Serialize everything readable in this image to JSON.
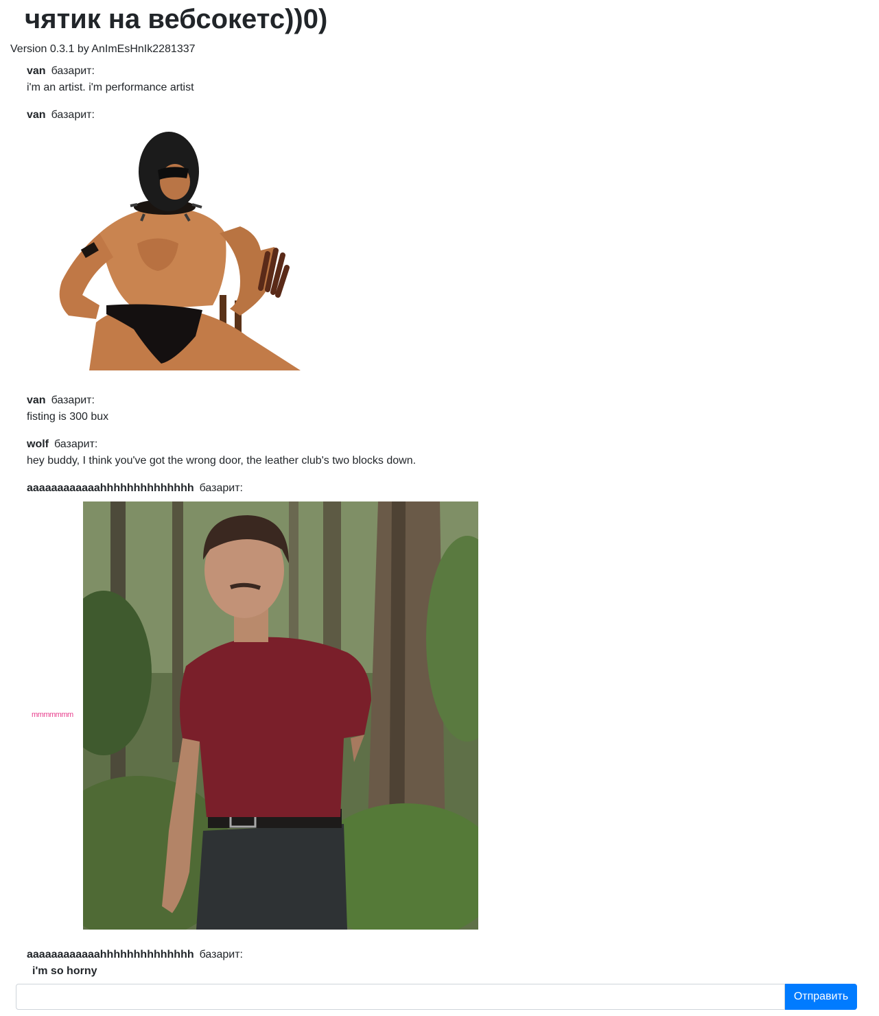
{
  "header": {
    "title": "чятик на вебсокетс))0)",
    "version": "Version 0.3.1 by AnImEsHnIk2281337"
  },
  "messages": [
    {
      "author": "van",
      "verb": "базарит:",
      "text": "i'm an artist. i'm performance artist"
    },
    {
      "author": "van",
      "verb": "базарит:",
      "image": "leather-performer-image"
    },
    {
      "author": "van",
      "verb": "базарит:",
      "text": "fisting is 300 bux"
    },
    {
      "author": "wolf",
      "verb": "базарит:",
      "text": "hey buddy, I think you've got the wrong door, the leather club's two blocks down."
    },
    {
      "author": "aaaaaaaaaaaahhhhhhhhhhhhhh",
      "verb": "базарит:",
      "marquee": "mmmmmmm",
      "image": "forest-man-image"
    },
    {
      "author": "aaaaaaaaaaaahhhhhhhhhhhhhh",
      "verb": "базарит:",
      "text": "i'm so horny"
    }
  ],
  "composer": {
    "input_value": "",
    "input_placeholder": "",
    "send_label": "Отправить"
  },
  "colors": {
    "accent": "#007bff",
    "marquee": "#e83e8c",
    "text": "#212529"
  }
}
